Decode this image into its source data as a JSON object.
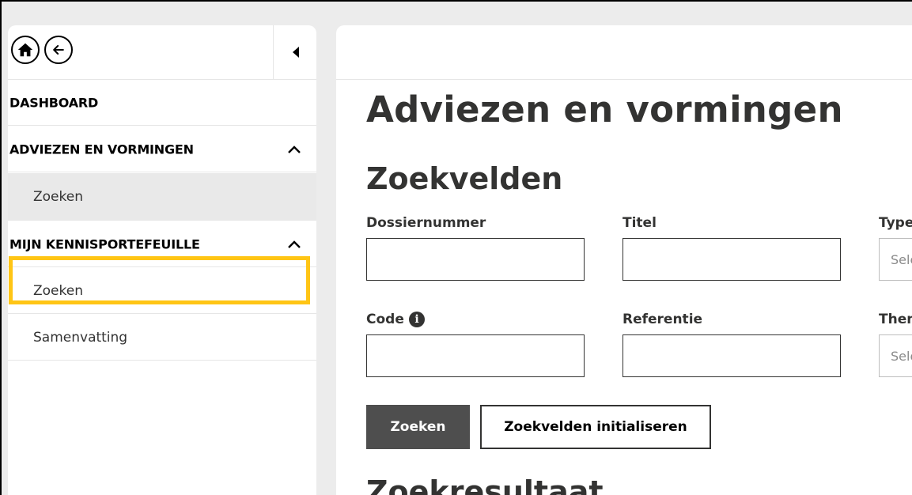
{
  "sidebar": {
    "home_icon": "home-icon",
    "back_icon": "arrow-left-icon",
    "collapse_icon": "triangle-left-icon",
    "dashboard": "DASHBOARD",
    "section1": {
      "label": "ADVIEZEN EN VORMINGEN",
      "items": [
        "Zoeken"
      ]
    },
    "section2": {
      "label": "MIJN KENNISPORTEFEUILLE",
      "items": [
        "Zoeken",
        "Samenvatting"
      ]
    }
  },
  "main": {
    "title": "Adviezen en vormingen",
    "search_heading": "Zoekvelden",
    "fields": {
      "dossiernummer": {
        "label": "Dossiernummer",
        "value": ""
      },
      "titel": {
        "label": "Titel",
        "value": ""
      },
      "type": {
        "label": "Type",
        "placeholder": "Selecteer"
      },
      "code": {
        "label": "Code",
        "value": ""
      },
      "referentie": {
        "label": "Referentie",
        "value": ""
      },
      "thema": {
        "label": "Thema",
        "placeholder": "Selecteer"
      }
    },
    "search_button": "Zoeken",
    "reset_button": "Zoekvelden initialiseren",
    "results_heading": "Zoekresultaat"
  },
  "colors": {
    "highlight": "#ffc515",
    "primary_button": "#4e4e4e",
    "text": "#333332",
    "background": "#ececec"
  }
}
